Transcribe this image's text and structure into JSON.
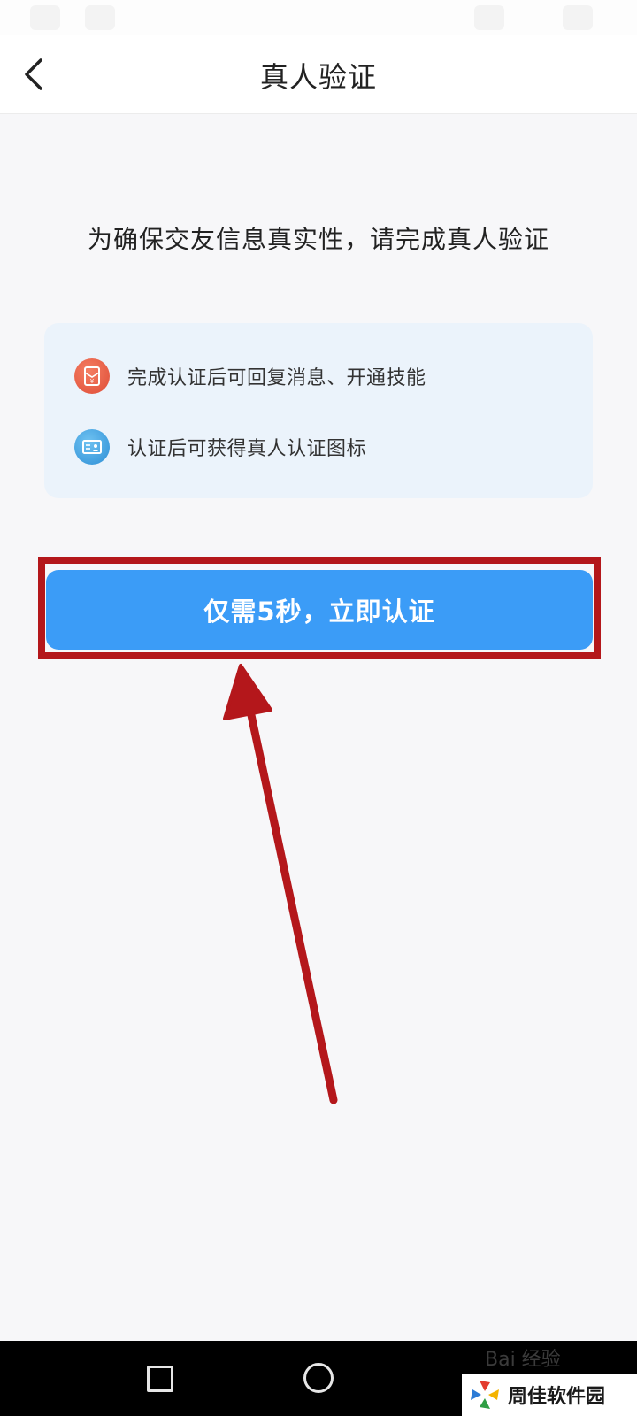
{
  "header": {
    "title": "真人验证",
    "back_icon": "chevron-left-icon"
  },
  "prompt": "为确保交友信息真实性，请完成真人验证",
  "benefits": [
    {
      "icon": "red-envelope-icon",
      "text": "完成认证后可回复消息、开通技能"
    },
    {
      "icon": "id-card-icon",
      "text": "认证后可获得真人认证图标"
    }
  ],
  "verify_button": {
    "label": "仅需5秒，立即认证"
  },
  "navigation": {
    "recents_icon": "square-icon",
    "home_icon": "circle-icon"
  },
  "watermark": {
    "text": "周佳软件园",
    "baidu_text": "Bai 经验"
  },
  "colors": {
    "primary_button": "#3b9cf7",
    "annotation_red": "#b4171b",
    "card_background": "#ebf3fb"
  }
}
